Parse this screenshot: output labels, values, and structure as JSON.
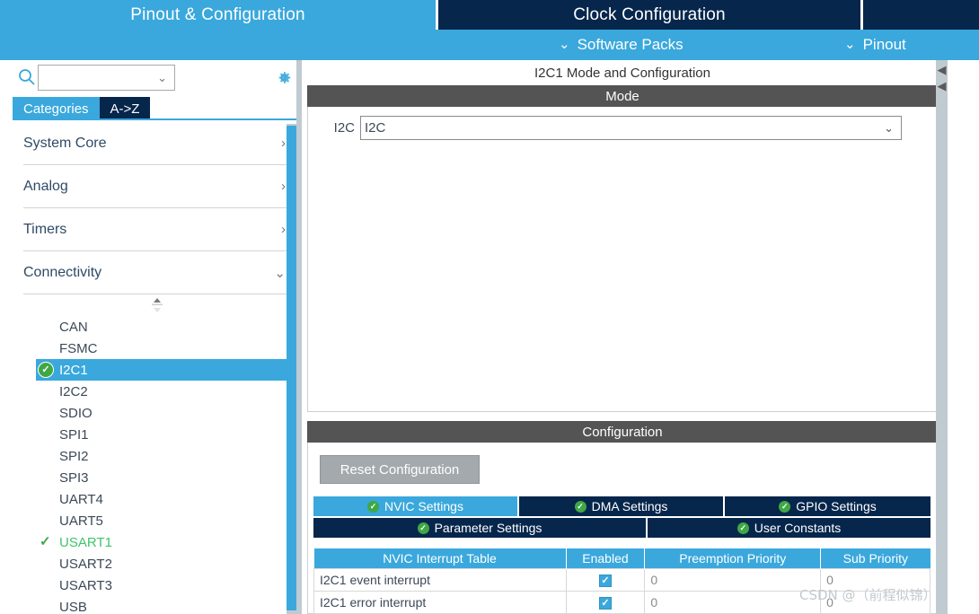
{
  "top_tabs": [
    {
      "label": "Pinout & Configuration",
      "state": "active"
    },
    {
      "label": "Clock Configuration",
      "state": "inactive"
    },
    {
      "label": "",
      "state": "inactive"
    }
  ],
  "sub_bar": {
    "software_packs": "Software Packs",
    "pinout": "Pinout",
    "chevron": "⌄"
  },
  "sidebar": {
    "search": {
      "value": "",
      "placeholder": "",
      "icon": "search-icon",
      "caret": "⌄"
    },
    "settings_icon": "gear-icon",
    "tabs": [
      {
        "label": "Categories",
        "state": "selected"
      },
      {
        "label": "A->Z",
        "state": "unselected"
      }
    ],
    "categories": [
      {
        "label": "System Core",
        "expanded": false,
        "arrow": "›"
      },
      {
        "label": "Analog",
        "expanded": false,
        "arrow": "›"
      },
      {
        "label": "Timers",
        "expanded": false,
        "arrow": "›"
      },
      {
        "label": "Connectivity",
        "expanded": true,
        "arrow": "⌄"
      }
    ],
    "peripherals": [
      {
        "label": "CAN",
        "state": "normal"
      },
      {
        "label": "FSMC",
        "state": "normal"
      },
      {
        "label": "I2C1",
        "state": "selected"
      },
      {
        "label": "I2C2",
        "state": "normal"
      },
      {
        "label": "SDIO",
        "state": "normal"
      },
      {
        "label": "SPI1",
        "state": "normal"
      },
      {
        "label": "SPI2",
        "state": "normal"
      },
      {
        "label": "SPI3",
        "state": "normal"
      },
      {
        "label": "UART4",
        "state": "normal"
      },
      {
        "label": "UART5",
        "state": "normal"
      },
      {
        "label": "USART1",
        "state": "enabled"
      },
      {
        "label": "USART2",
        "state": "normal"
      },
      {
        "label": "USART3",
        "state": "normal"
      },
      {
        "label": "USB",
        "state": "normal"
      }
    ]
  },
  "main": {
    "title": "I2C1 Mode and Configuration",
    "mode_section": {
      "header": "Mode",
      "i2c_label": "I2C",
      "i2c_value": "I2C",
      "caret": "⌄"
    },
    "configuration_section": {
      "header": "Configuration",
      "reset_button": "Reset Configuration",
      "tabs_row1": [
        {
          "label": "NVIC Settings",
          "state": "active",
          "check": true
        },
        {
          "label": "DMA Settings",
          "state": "idle",
          "check": true
        },
        {
          "label": "GPIO Settings",
          "state": "idle",
          "check": true
        }
      ],
      "tabs_row2": [
        {
          "label": "Parameter Settings",
          "state": "idle",
          "check": true
        },
        {
          "label": "User Constants",
          "state": "idle",
          "check": true
        }
      ],
      "nvic_table": {
        "columns": [
          "NVIC Interrupt Table",
          "Enabled",
          "Preemption Priority",
          "Sub Priority"
        ],
        "rows": [
          {
            "name": "I2C1 event interrupt",
            "enabled": true,
            "preemption": "0",
            "sub": "0"
          },
          {
            "name": "I2C1 error interrupt",
            "enabled": true,
            "preemption": "0",
            "sub": "0"
          }
        ]
      }
    }
  },
  "watermark": "CSDN @（前程似锦）",
  "colors": {
    "accent_light_blue": "#3aa8dc",
    "accent_dark_navy": "#06264c",
    "header_gray": "#545454",
    "enabled_green": "#3fa845"
  }
}
